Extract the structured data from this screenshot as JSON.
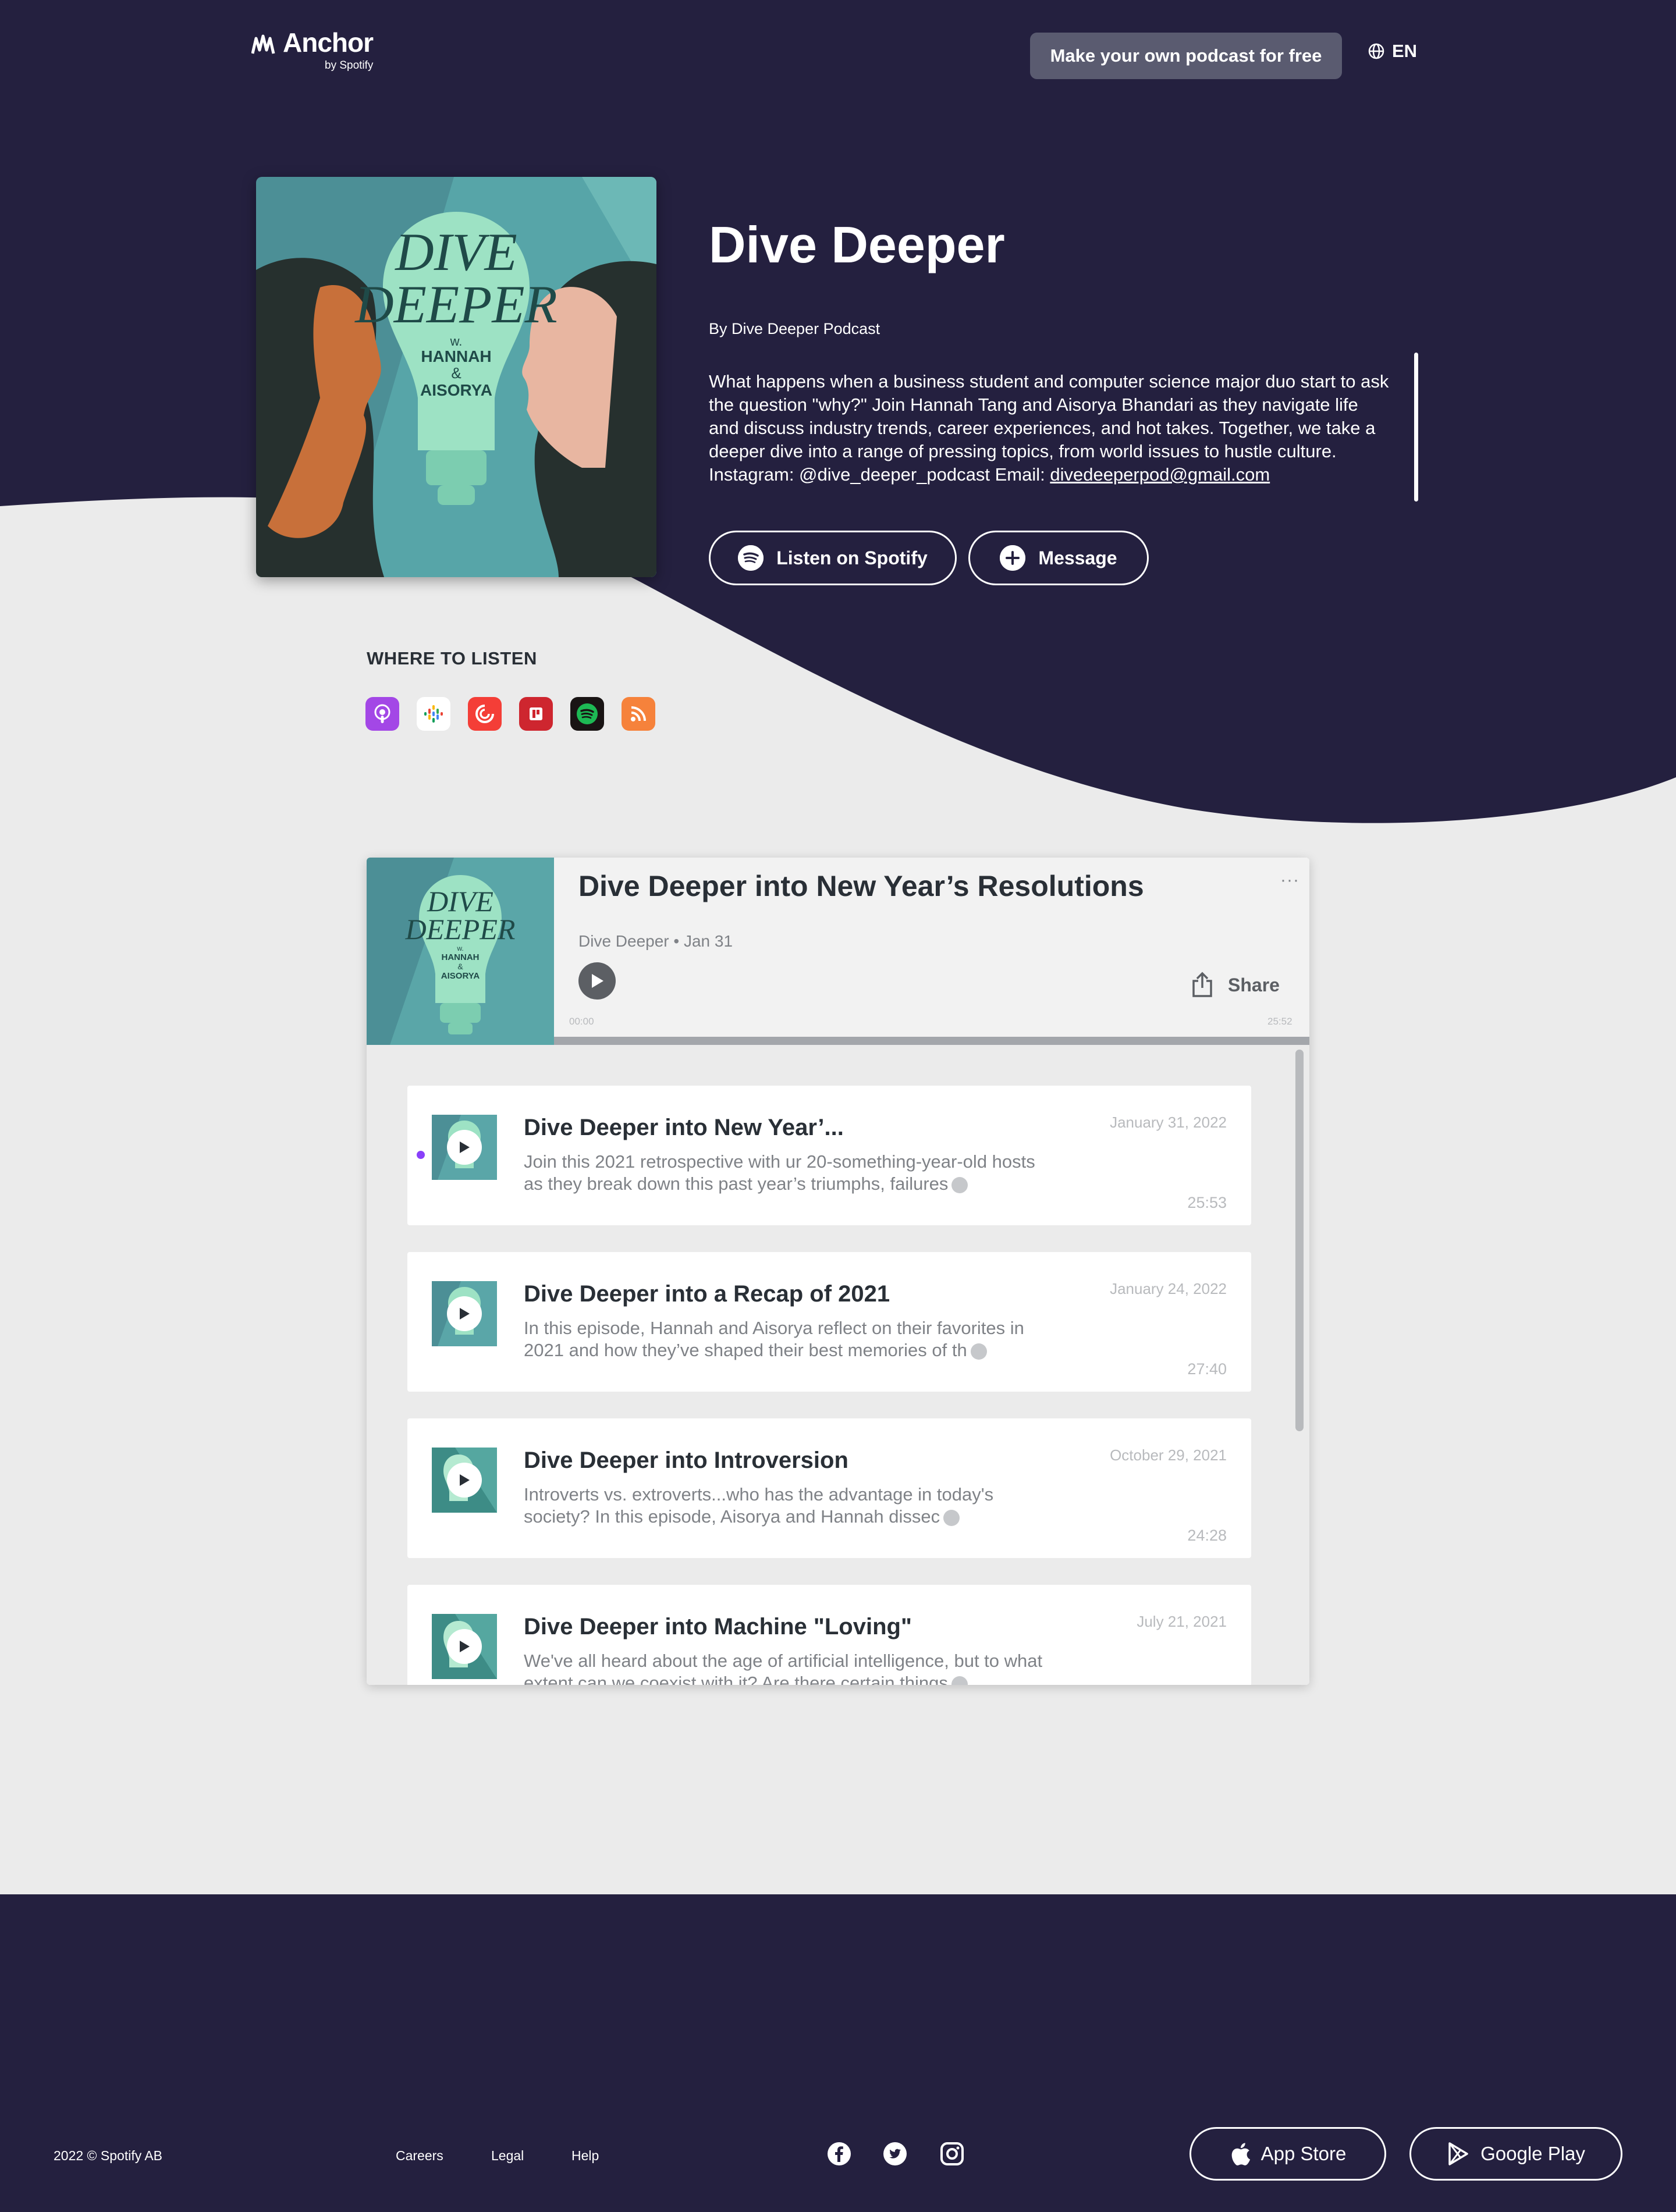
{
  "colors": {
    "navy": "#24203f",
    "background": "#ebebeb",
    "accent_purple": "#8940fa",
    "spotify_green": "#1db954"
  },
  "header": {
    "logo_text": "Anchor",
    "logo_sub": "by Spotify",
    "cta_label": "Make your own podcast for free",
    "language": "EN",
    "language_icon": "globe-icon"
  },
  "podcast": {
    "title": "Dive Deeper",
    "author": "By Dive Deeper Podcast",
    "description": "What happens when a business student and computer science major duo start to ask the question \"why?\" Join Hannah Tang and Aisorya Bhandari as they navigate life and discuss industry trends, career experiences, and hot takes. Together, we take a deeper dive into a range of pressing topics, from world issues to hustle culture. Instagram: @dive_deeper_podcast Email: ",
    "email": "divedeeperpod@gmail.com",
    "cover_text": {
      "line1": "DIVE",
      "line2": "DEEPER",
      "line3": "w.",
      "line4": "HANNAH",
      "line5": "&",
      "line6": "AISORYA"
    },
    "listen_label": "Listen on Spotify",
    "message_label": "Message"
  },
  "where_to_listen": {
    "title": "WHERE TO LISTEN",
    "platforms": [
      {
        "name": "Apple Podcasts",
        "icon": "apple-podcasts-icon",
        "color": "#a347e6"
      },
      {
        "name": "Google Podcasts",
        "icon": "google-podcasts-icon",
        "color": "#ffffff"
      },
      {
        "name": "Pocket Casts",
        "icon": "pocket-casts-icon",
        "color": "#f43e37"
      },
      {
        "name": "RadioPublic",
        "icon": "radiopublic-icon",
        "color": "#ce262f"
      },
      {
        "name": "Spotify",
        "icon": "spotify-icon",
        "color": "#191414"
      },
      {
        "name": "RSS",
        "icon": "rss-icon",
        "color": "#f6823b"
      }
    ]
  },
  "player": {
    "title": "Dive Deeper into New Year’s Resolutions",
    "meta": "Dive Deeper • Jan 31",
    "menu": "···",
    "share_label": "Share",
    "time_start": "00:00",
    "time_end": "25:52",
    "progress": 0
  },
  "episodes": [
    {
      "title": "Dive Deeper into New Year’...",
      "description": "Join this 2021 retrospective with ur 20-something-year-old hosts as they break down this past year’s triumphs, failures",
      "date": "January 31, 2022",
      "duration": "25:53",
      "active": true
    },
    {
      "title": "Dive Deeper into a Recap of 2021",
      "description": "In this episode, Hannah and Aisorya reflect on their favorites in 2021 and how they’ve shaped their best memories of th",
      "date": "January 24, 2022",
      "duration": "27:40",
      "active": false
    },
    {
      "title": "Dive Deeper into Introversion",
      "description": "Introverts vs. extroverts...who has the advantage in today's society? In this episode, Aisorya and Hannah dissec",
      "date": "October 29, 2021",
      "duration": "24:28",
      "active": false
    },
    {
      "title": "Dive Deeper into Machine \"Loving\"",
      "description": "We've all heard about the age of artificial intelligence, but to what extent can we coexist with it? Are there certain things",
      "date": "July 21, 2021",
      "duration": "",
      "active": false
    }
  ],
  "footer": {
    "copyright": "2022 © Spotify AB",
    "links": [
      "Careers",
      "Legal",
      "Help"
    ],
    "social": [
      "facebook-icon",
      "twitter-icon",
      "instagram-icon"
    ],
    "app_store": "App Store",
    "google_play": "Google Play"
  }
}
